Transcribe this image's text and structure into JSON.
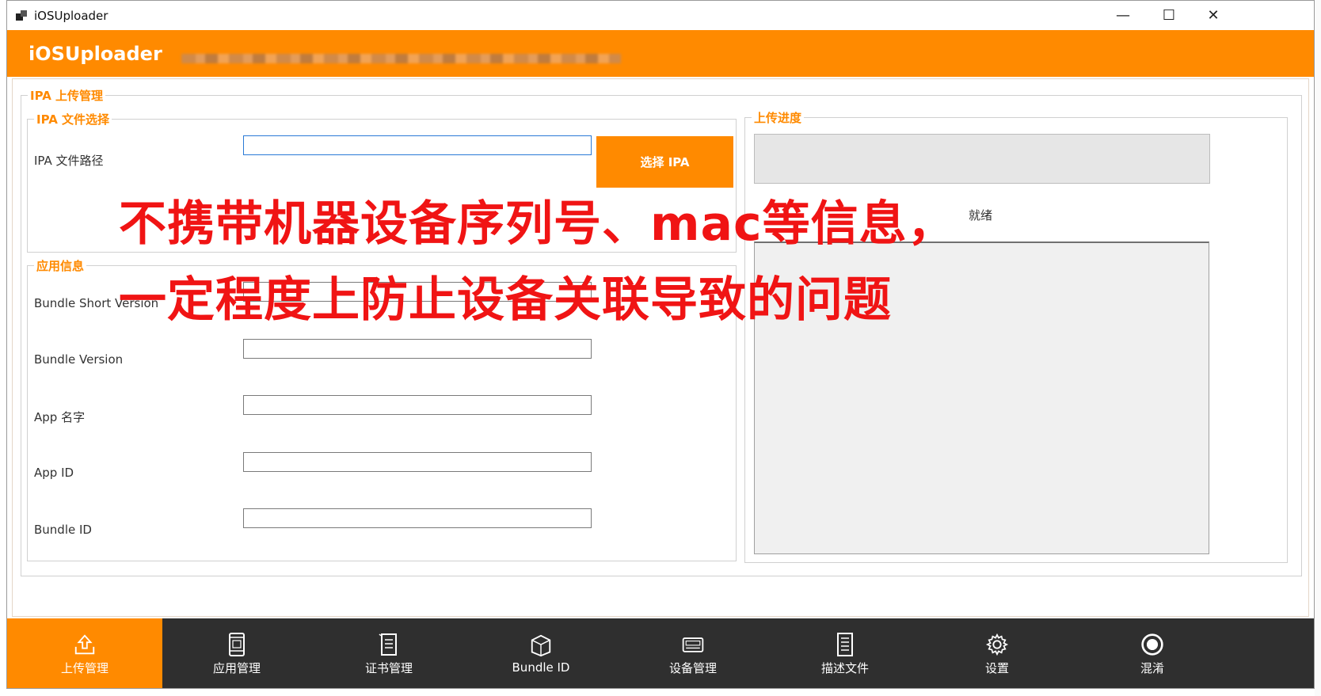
{
  "window": {
    "title": "iOSUploader",
    "controls": {
      "minimize": "—",
      "maximize": "☐",
      "close": "✕"
    }
  },
  "header": {
    "brand": "iOSUploader"
  },
  "ipa_manage": {
    "legend": "IPA 上传管理",
    "file_select": {
      "legend": "IPA 文件选择",
      "path_label": "IPA 文件路径",
      "path_value": "",
      "button_label": "选择 IPA"
    },
    "app_info": {
      "legend": "应用信息",
      "fields": [
        {
          "label": "Bundle Short Version",
          "value": ""
        },
        {
          "label": "Bundle Version",
          "value": ""
        },
        {
          "label": "App 名字",
          "value": ""
        },
        {
          "label": "App ID",
          "value": ""
        },
        {
          "label": "Bundle ID",
          "value": ""
        }
      ]
    }
  },
  "upload_progress": {
    "legend": "上传进度",
    "status": "就绪",
    "progress": 0
  },
  "overlay": {
    "line1": "不携带机器设备序列号、mac等信息，",
    "line2": "一定程度上防止设备关联导致的问题"
  },
  "nav": {
    "active_index": 0,
    "items": [
      {
        "label": "上传管理",
        "icon": "upload-icon"
      },
      {
        "label": "应用管理",
        "icon": "phone-icon"
      },
      {
        "label": "证书管理",
        "icon": "certificate-icon"
      },
      {
        "label": "Bundle ID",
        "icon": "box-icon"
      },
      {
        "label": "设备管理",
        "icon": "device-icon"
      },
      {
        "label": "描述文件",
        "icon": "document-icon"
      },
      {
        "label": "设置",
        "icon": "gear-icon"
      },
      {
        "label": "混淆",
        "icon": "circle-icon"
      }
    ]
  },
  "colors": {
    "accent": "#ff8a00",
    "nav_bg": "#2f2f2f",
    "overlay_text": "#f01414"
  }
}
